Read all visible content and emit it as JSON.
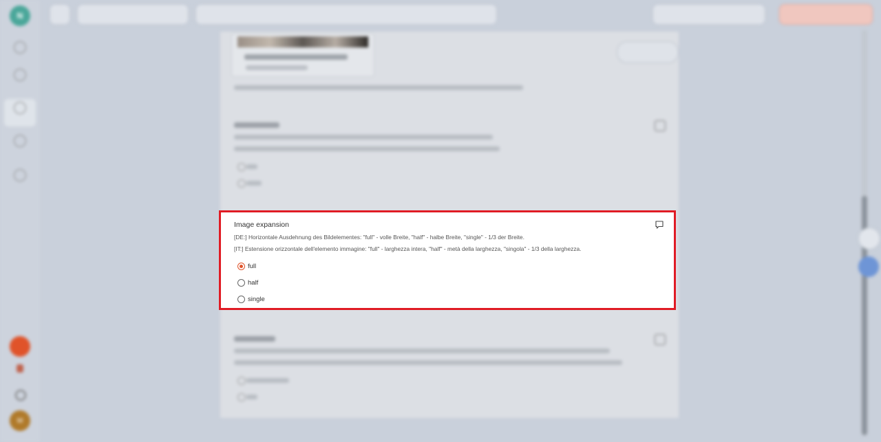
{
  "sidebar": {
    "logo_text": "N",
    "user_initials": "M"
  },
  "field": {
    "title": "Image expansion",
    "description_de": "[DE:] Horizontale Ausdehnung des Bildelementes: \"full\" - volle Breite, \"half\" - halbe Breite, \"single\" - 1/3 der Breite.",
    "description_it": "[IT:] Estensione orizzontale dell'elemento immagine: \"full\" - larghezza intera, \"half\" - metà della larghezza, \"singola\" - 1/3 della larghezza.",
    "options": [
      {
        "label": "full",
        "selected": true
      },
      {
        "label": "half",
        "selected": false
      },
      {
        "label": "single",
        "selected": false
      }
    ],
    "comment_icon": "comment-icon"
  },
  "colors": {
    "highlight_border": "#e01b24",
    "radio_accent": "#e0532a"
  }
}
